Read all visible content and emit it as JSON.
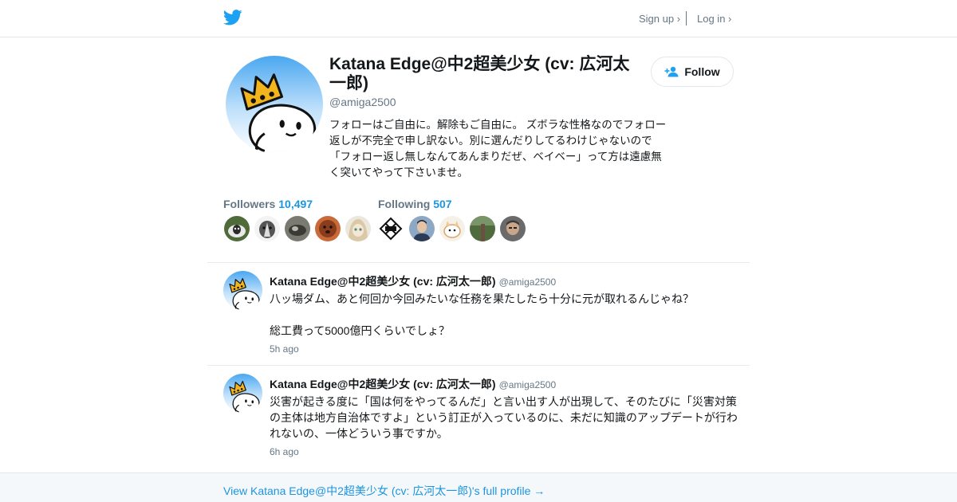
{
  "header": {
    "logo_icon": "twitter-bird-icon",
    "brand_color": "#1da1f2",
    "signup_label": "Sign up ›",
    "login_label": "Log in ›"
  },
  "profile": {
    "display_name": "Katana Edge@中2超美少女 (cv: 広河太一郎)",
    "screen_name": "@amiga2500",
    "bio": "フォローはご自由に。解除もご自由に。 ズボラな性格なのでフォロー返しが不完全で申し訳ない。別に選んだりしてるわけじゃないので「フォロー返し無しなんてあんまりだぜ、ベイベー」って方は遠慮無く突いてやって下さいませ。",
    "follow_label": "Follow",
    "follow_icon": "person-add-icon",
    "followers_label": "Followers",
    "followers_count": "10,497",
    "following_label": "Following",
    "following_count": "507",
    "accent_color": "#1b95e0"
  },
  "tweets": [
    {
      "author": "Katana Edge@中2超美少女 (cv: 広河太一郎)",
      "handle": "@amiga2500",
      "text": "八ッ場ダム、あと何回か今回みたいな任務を果たしたら十分に元が取れるんじゃね？\n\n総工費って5000億円くらいでしょ？",
      "time": "5h ago"
    },
    {
      "author": "Katana Edge@中2超美少女 (cv: 広河太一郎)",
      "handle": "@amiga2500",
      "text": "災害が起きる度に「国は何をやってるんだ」と言い出す人が出現して、そのたびに「災害対策の主体は地方自治体ですよ」という訂正が入っているのに、未だに知識のアップデートが行われないの、一体どういう事ですか。",
      "time": "6h ago"
    }
  ],
  "footer": {
    "full_profile_label": "View Katana Edge@中2超美少女 (cv: 広河太一郎)'s full profile →"
  }
}
